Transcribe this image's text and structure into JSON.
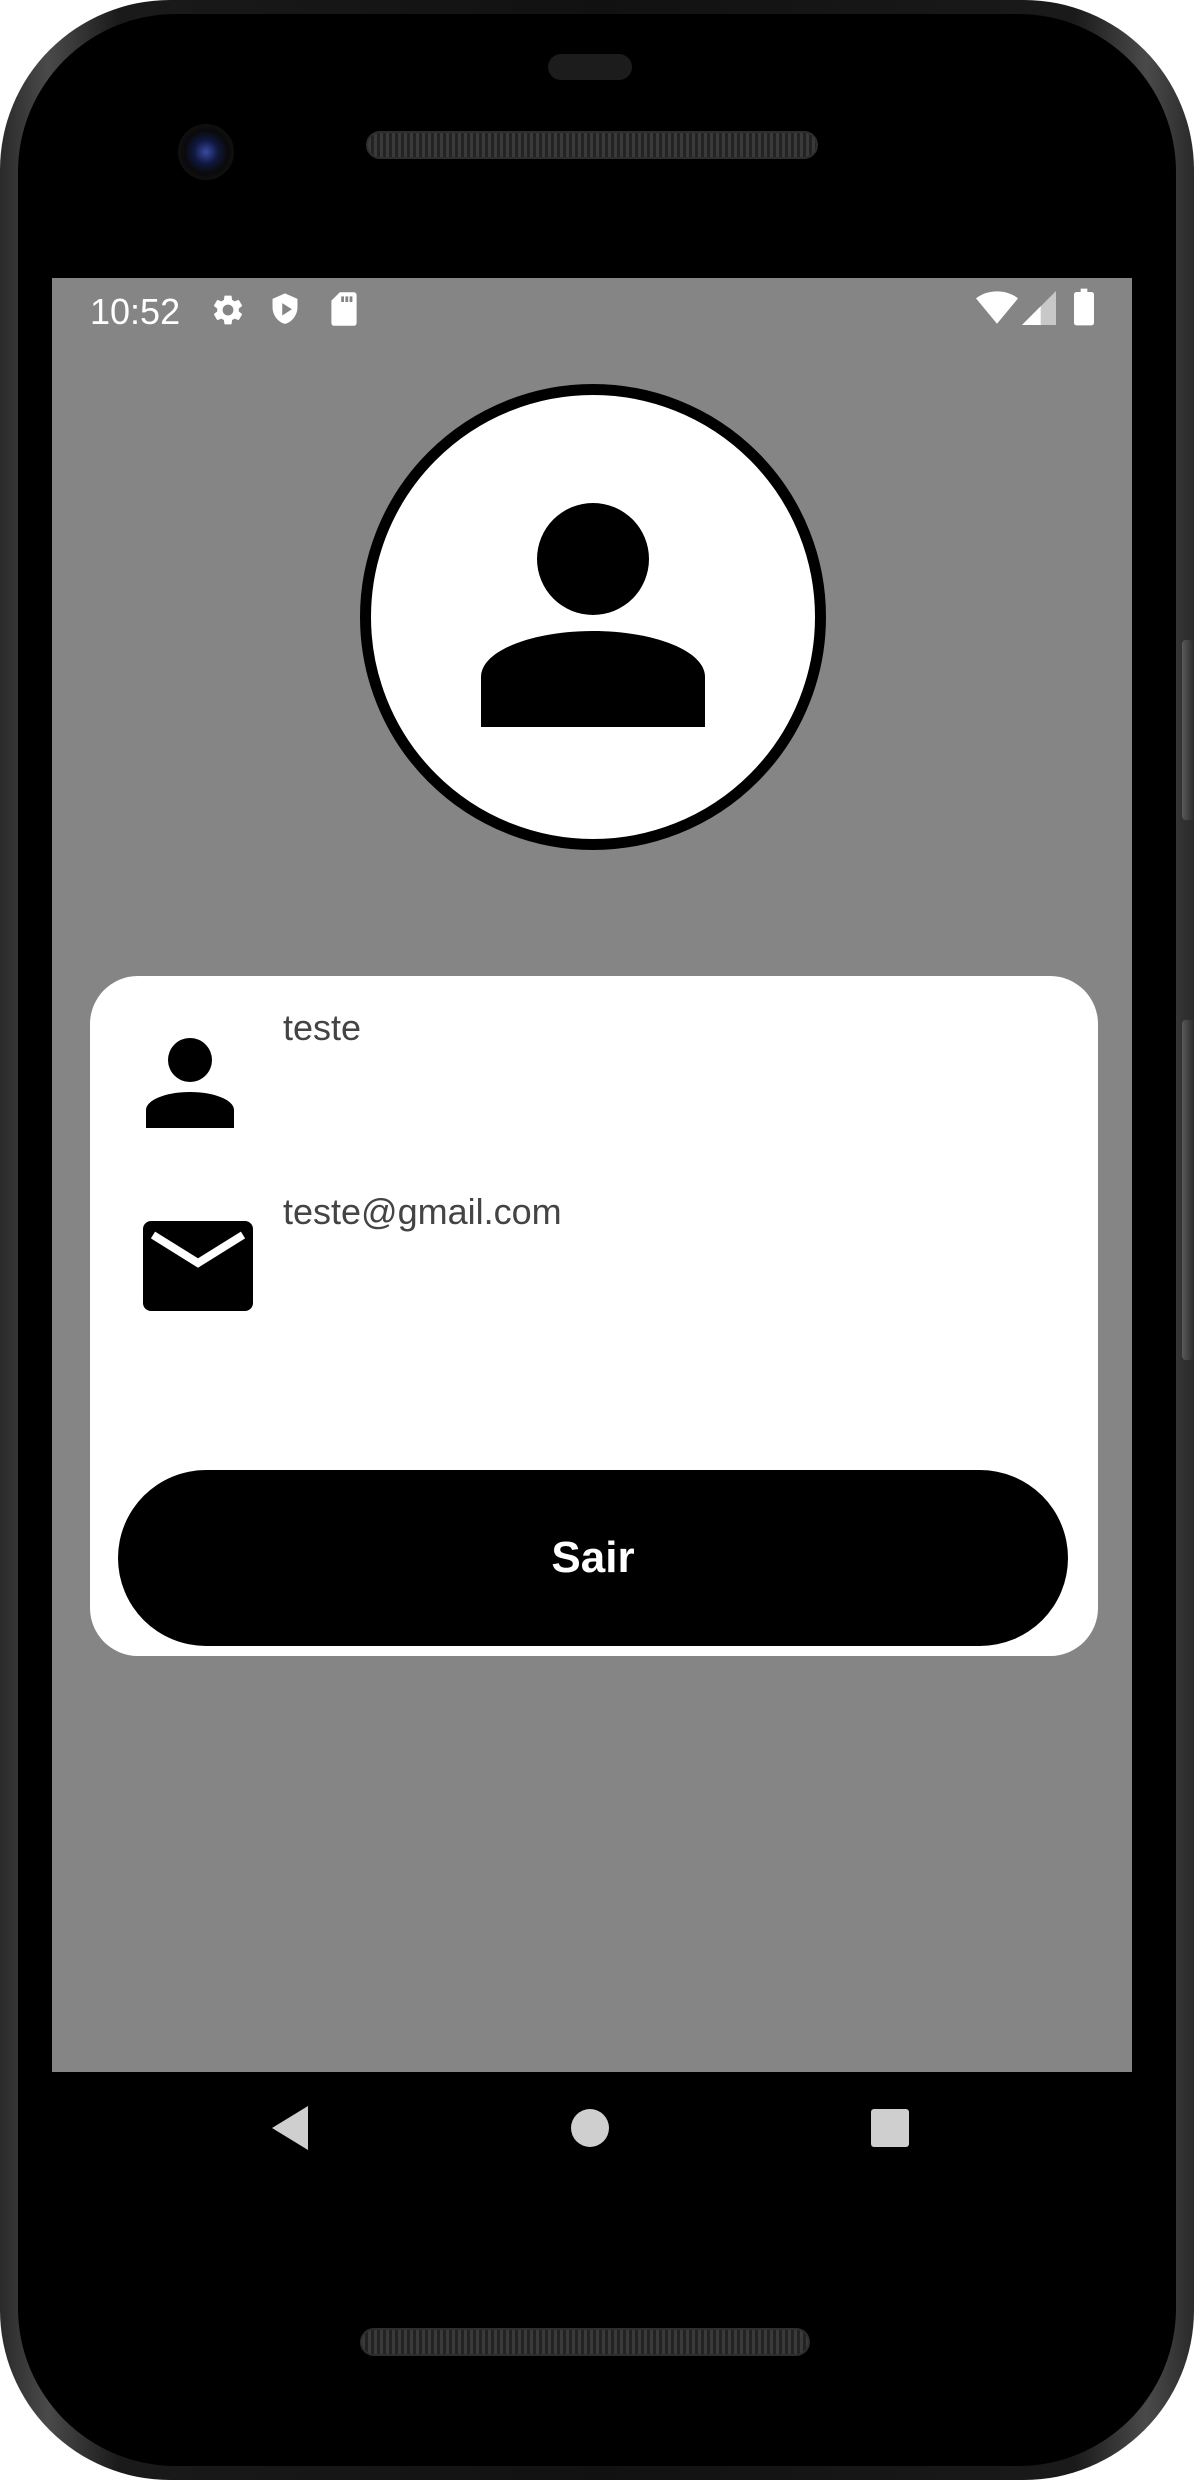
{
  "status_bar": {
    "time": "10:52",
    "left_icons": [
      "gear-icon",
      "shield-play-icon",
      "sd-card-icon"
    ],
    "right_icons": [
      "wifi-icon",
      "signal-icon",
      "battery-icon"
    ]
  },
  "profile": {
    "avatar_icon": "person-icon",
    "name": "teste",
    "email": "teste@gmail.com",
    "name_icon": "person-icon",
    "email_icon": "mail-icon"
  },
  "actions": {
    "logout_label": "Sair"
  },
  "navigation": {
    "buttons": [
      "back-icon",
      "home-icon",
      "recents-icon"
    ]
  },
  "colors": {
    "screen_background": "#858585",
    "card_background": "#ffffff",
    "button_background": "#000000",
    "button_text": "#ffffff"
  }
}
